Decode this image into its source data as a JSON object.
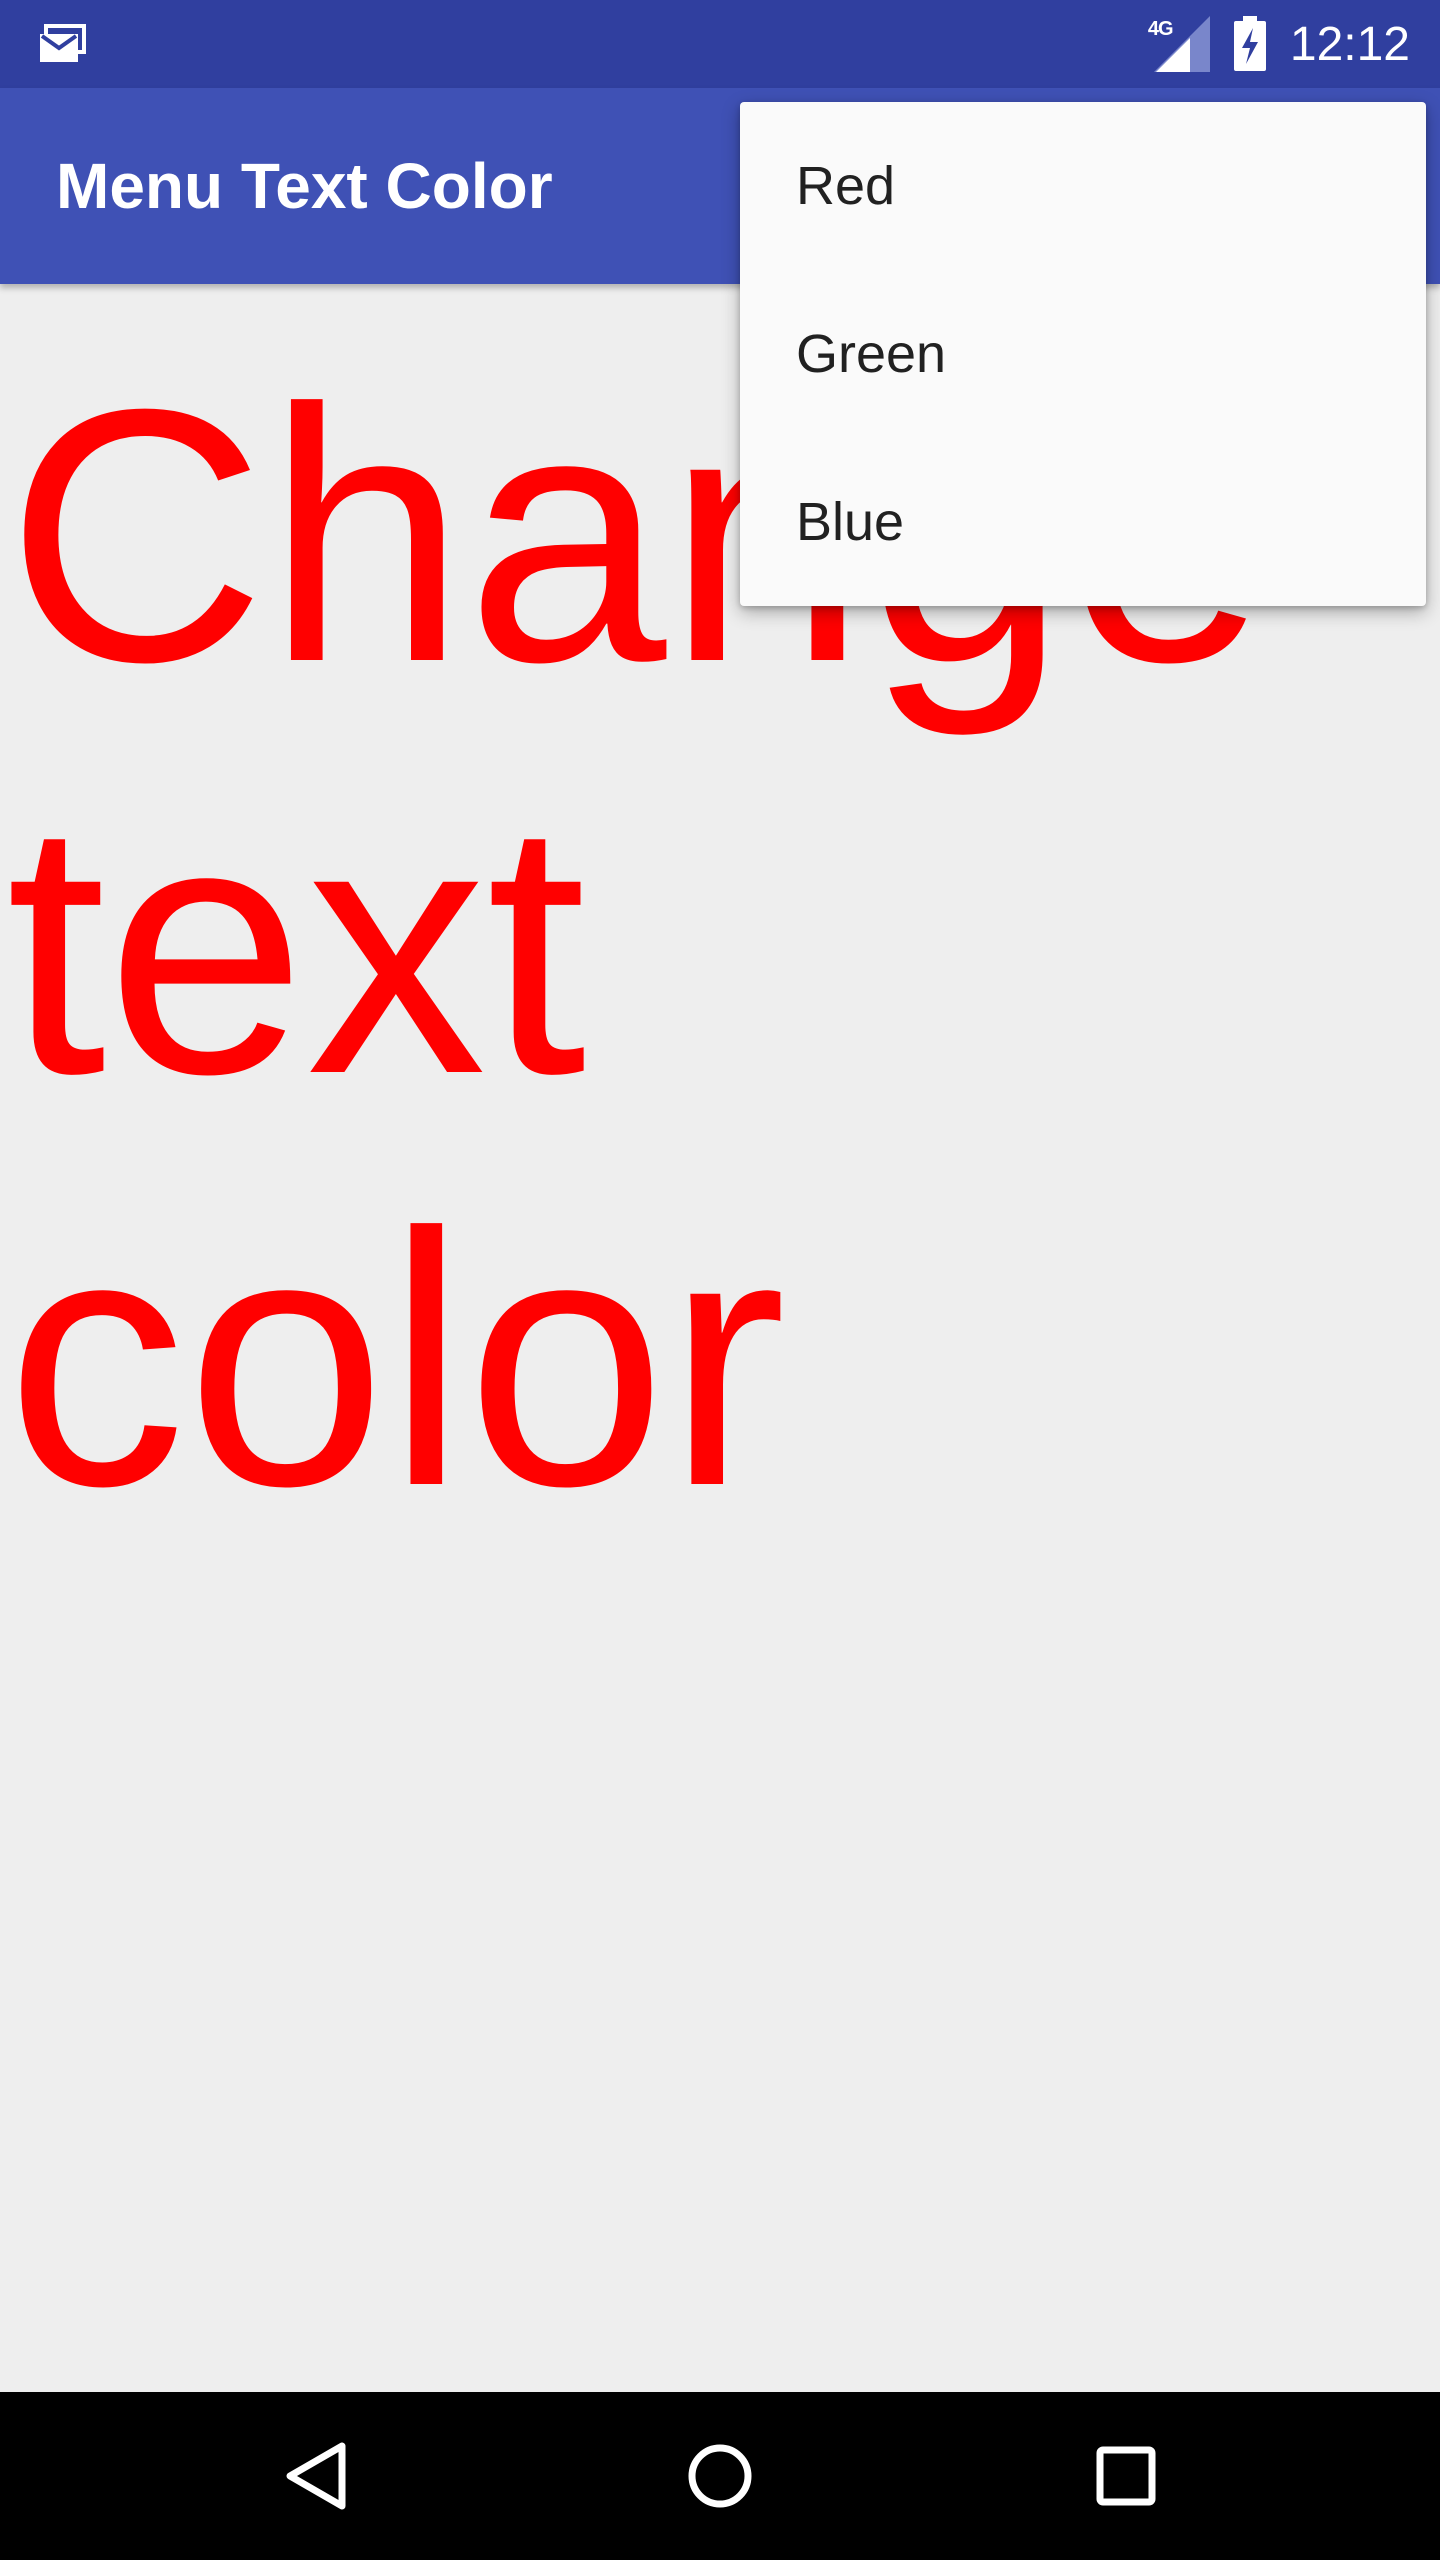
{
  "status_bar": {
    "notification_icon": "email-notification-icon",
    "network_label": "4G",
    "signal_icon": "signal-strength-icon",
    "battery_icon": "battery-charging-icon",
    "time": "12:12",
    "background_color": "#303f9f"
  },
  "app_bar": {
    "title": "Menu Text Color",
    "background_color": "#3f51b5"
  },
  "main": {
    "text": "Change text color",
    "text_color": "#ff0000"
  },
  "menu": {
    "items": [
      {
        "label": "Red"
      },
      {
        "label": "Green"
      },
      {
        "label": "Blue"
      }
    ]
  },
  "nav_bar": {
    "back_icon": "back-triangle-icon",
    "home_icon": "home-circle-icon",
    "recent_icon": "recent-apps-square-icon"
  }
}
